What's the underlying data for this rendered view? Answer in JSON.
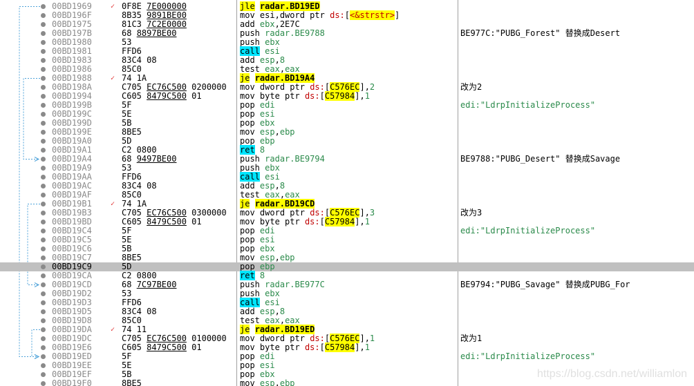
{
  "disassembly": {
    "selected_address": "00BD19C9",
    "rows": [
      {
        "addr": "00BD1969",
        "mark": "✓",
        "bytes": "0F8E 7E000000",
        "mnem": "jle",
        "ops": "radar.BD19ED",
        "hl": "yellow",
        "cmt": ""
      },
      {
        "addr": "00BD196F",
        "mark": "",
        "bytes": "8B35 9891BE00",
        "mnem": "mov",
        "ops": "esi,dword ptr ds:[<&strstr>]",
        "cmt": ""
      },
      {
        "addr": "00BD1975",
        "mark": "",
        "bytes": "81C3 7C2E0000",
        "mnem": "add",
        "ops": "ebx,2E7C",
        "cmt": ""
      },
      {
        "addr": "00BD197B",
        "mark": "",
        "bytes": "68 8897BE00",
        "mnem": "push",
        "ops": "radar.BE9788",
        "cmt": "BE977C:\"PUBG_Forest\" 替换成Desert"
      },
      {
        "addr": "00BD1980",
        "mark": "",
        "bytes": "53",
        "mnem": "push",
        "ops": "ebx",
        "cmt": ""
      },
      {
        "addr": "00BD1981",
        "mark": "",
        "bytes": "FFD6",
        "mnem": "call",
        "ops": "esi",
        "hl": "cyan",
        "cmt": ""
      },
      {
        "addr": "00BD1983",
        "mark": "",
        "bytes": "83C4 08",
        "mnem": "add",
        "ops": "esp,8",
        "cmt": ""
      },
      {
        "addr": "00BD1986",
        "mark": "",
        "bytes": "85C0",
        "mnem": "test",
        "ops": "eax,eax",
        "cmt": ""
      },
      {
        "addr": "00BD1988",
        "mark": "✓",
        "bytes": "74 1A",
        "mnem": "je",
        "ops": "radar.BD19A4",
        "hl": "yellow",
        "cmt": ""
      },
      {
        "addr": "00BD198A",
        "mark": "",
        "bytes": "C705 EC76C500 0200000",
        "mnem": "mov",
        "ops": "dword ptr ds:[C576EC],2",
        "cmt": "改为2"
      },
      {
        "addr": "00BD1994",
        "mark": "",
        "bytes": "C605 8479C500 01",
        "mnem": "mov",
        "ops": "byte ptr ds:[C57984],1",
        "cmt": ""
      },
      {
        "addr": "00BD199B",
        "mark": "",
        "bytes": "5F",
        "mnem": "pop",
        "ops": "edi",
        "cmt": "edi:\"LdrpInitializeProcess\"",
        "cmt_str": true
      },
      {
        "addr": "00BD199C",
        "mark": "",
        "bytes": "5E",
        "mnem": "pop",
        "ops": "esi",
        "cmt": ""
      },
      {
        "addr": "00BD199D",
        "mark": "",
        "bytes": "5B",
        "mnem": "pop",
        "ops": "ebx",
        "cmt": ""
      },
      {
        "addr": "00BD199E",
        "mark": "",
        "bytes": "8BE5",
        "mnem": "mov",
        "ops": "esp,ebp",
        "cmt": ""
      },
      {
        "addr": "00BD19A0",
        "mark": "",
        "bytes": "5D",
        "mnem": "pop",
        "ops": "ebp",
        "cmt": ""
      },
      {
        "addr": "00BD19A1",
        "mark": "",
        "bytes": "C2 0800",
        "mnem": "ret",
        "ops": "8",
        "hl": "cyan",
        "cmt": ""
      },
      {
        "addr": "00BD19A4",
        "mark": "",
        "bytes": "68 9497BE00",
        "mnem": "push",
        "ops": "radar.BE9794",
        "cmt": "BE9788:\"PUBG_Desert\" 替换成Savage"
      },
      {
        "addr": "00BD19A9",
        "mark": "",
        "bytes": "53",
        "mnem": "push",
        "ops": "ebx",
        "cmt": ""
      },
      {
        "addr": "00BD19AA",
        "mark": "",
        "bytes": "FFD6",
        "mnem": "call",
        "ops": "esi",
        "hl": "cyan",
        "cmt": ""
      },
      {
        "addr": "00BD19AC",
        "mark": "",
        "bytes": "83C4 08",
        "mnem": "add",
        "ops": "esp,8",
        "cmt": ""
      },
      {
        "addr": "00BD19AF",
        "mark": "",
        "bytes": "85C0",
        "mnem": "test",
        "ops": "eax,eax",
        "cmt": ""
      },
      {
        "addr": "00BD19B1",
        "mark": "✓",
        "bytes": "74 1A",
        "mnem": "je",
        "ops": "radar.BD19CD",
        "hl": "yellow",
        "cmt": ""
      },
      {
        "addr": "00BD19B3",
        "mark": "",
        "bytes": "C705 EC76C500 0300000",
        "mnem": "mov",
        "ops": "dword ptr ds:[C576EC],3",
        "cmt": "改为3"
      },
      {
        "addr": "00BD19BD",
        "mark": "",
        "bytes": "C605 8479C500 01",
        "mnem": "mov",
        "ops": "byte ptr ds:[C57984],1",
        "cmt": ""
      },
      {
        "addr": "00BD19C4",
        "mark": "",
        "bytes": "5F",
        "mnem": "pop",
        "ops": "edi",
        "cmt": "edi:\"LdrpInitializeProcess\"",
        "cmt_str": true
      },
      {
        "addr": "00BD19C5",
        "mark": "",
        "bytes": "5E",
        "mnem": "pop",
        "ops": "esi",
        "cmt": ""
      },
      {
        "addr": "00BD19C6",
        "mark": "",
        "bytes": "5B",
        "mnem": "pop",
        "ops": "ebx",
        "cmt": ""
      },
      {
        "addr": "00BD19C7",
        "mark": "",
        "bytes": "8BE5",
        "mnem": "mov",
        "ops": "esp,ebp",
        "cmt": ""
      },
      {
        "addr": "00BD19C9",
        "mark": "",
        "bytes": "5D",
        "mnem": "pop",
        "ops": "ebp",
        "cmt": "",
        "selected": true
      },
      {
        "addr": "00BD19CA",
        "mark": "",
        "bytes": "C2 0800",
        "mnem": "ret",
        "ops": "8",
        "hl": "cyan",
        "cmt": ""
      },
      {
        "addr": "00BD19CD",
        "mark": "",
        "bytes": "68 7C97BE00",
        "mnem": "push",
        "ops": "radar.BE977C",
        "cmt": "BE9794:\"PUBG_Savage\" 替换成PUBG_For"
      },
      {
        "addr": "00BD19D2",
        "mark": "",
        "bytes": "53",
        "mnem": "push",
        "ops": "ebx",
        "cmt": ""
      },
      {
        "addr": "00BD19D3",
        "mark": "",
        "bytes": "FFD6",
        "mnem": "call",
        "ops": "esi",
        "hl": "cyan",
        "cmt": ""
      },
      {
        "addr": "00BD19D5",
        "mark": "",
        "bytes": "83C4 08",
        "mnem": "add",
        "ops": "esp,8",
        "cmt": ""
      },
      {
        "addr": "00BD19D8",
        "mark": "",
        "bytes": "85C0",
        "mnem": "test",
        "ops": "eax,eax",
        "cmt": ""
      },
      {
        "addr": "00BD19DA",
        "mark": "✓",
        "bytes": "74 11",
        "mnem": "je",
        "ops": "radar.BD19ED",
        "hl": "yellow",
        "cmt": ""
      },
      {
        "addr": "00BD19DC",
        "mark": "",
        "bytes": "C705 EC76C500 0100000",
        "mnem": "mov",
        "ops": "dword ptr ds:[C576EC],1",
        "cmt": "改为1"
      },
      {
        "addr": "00BD19E6",
        "mark": "",
        "bytes": "C605 8479C500 01",
        "mnem": "mov",
        "ops": "byte ptr ds:[C57984],1",
        "cmt": ""
      },
      {
        "addr": "00BD19ED",
        "mark": "",
        "bytes": "5F",
        "mnem": "pop",
        "ops": "edi",
        "cmt": "edi:\"LdrpInitializeProcess\"",
        "cmt_str": true
      },
      {
        "addr": "00BD19EE",
        "mark": "",
        "bytes": "5E",
        "mnem": "pop",
        "ops": "esi",
        "cmt": ""
      },
      {
        "addr": "00BD19EF",
        "mark": "",
        "bytes": "5B",
        "mnem": "pop",
        "ops": "ebx",
        "cmt": ""
      },
      {
        "addr": "00BD19F0",
        "mark": "",
        "bytes": "8BE5",
        "mnem": "mov",
        "ops": "esp,ebp",
        "cmt": ""
      }
    ]
  },
  "watermark": "https://blog.csdn.net/williamlon",
  "colors": {
    "selection": "#c0c0c0",
    "jump_highlight": "#ffff00",
    "call_highlight": "#00e5ff",
    "comment_string": "#2a8a4a",
    "arrow": "#4aa0d8"
  }
}
